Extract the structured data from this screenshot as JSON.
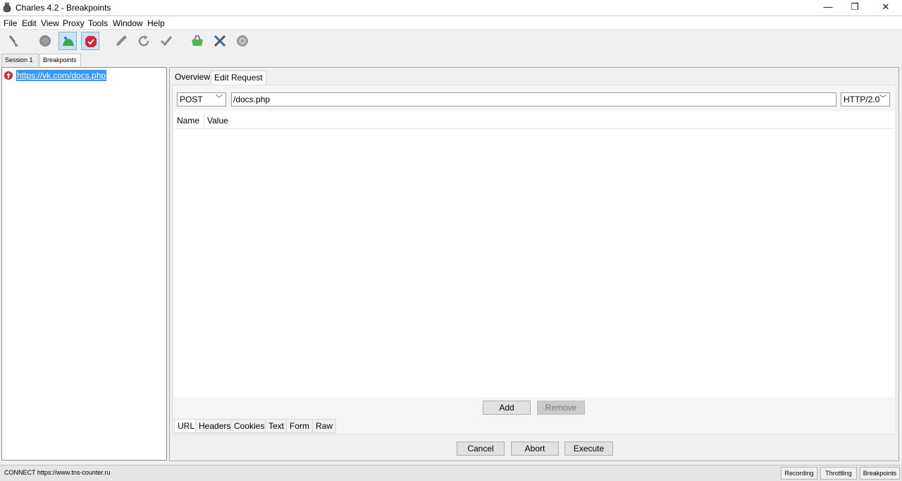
{
  "window": {
    "title": "Charles 4.2 - Breakpoints",
    "controls": {
      "minimize": "—",
      "restore": "❐",
      "close": "✕"
    }
  },
  "menu": [
    "File",
    "Edit",
    "View",
    "Proxy",
    "Tools",
    "Window",
    "Help"
  ],
  "toolbar": {
    "buttons": [
      {
        "icon": "broom-icon"
      },
      {
        "icon": "record-icon"
      },
      {
        "icon": "throttle-icon",
        "active": true
      },
      {
        "icon": "breakpoint-icon",
        "active": true
      },
      {
        "icon": "pen-icon"
      },
      {
        "icon": "refresh-icon"
      },
      {
        "icon": "check-icon"
      },
      {
        "icon": "basket-icon"
      },
      {
        "icon": "tools-icon"
      },
      {
        "icon": "settings-gear-icon"
      }
    ]
  },
  "session_tabs": {
    "session": "Session 1",
    "session_modified": "*",
    "breakpoints": "Breakpoints"
  },
  "tree": {
    "selected_url": "https://vk.com/docs.php"
  },
  "panel_tabs": {
    "overview": "Overview",
    "edit_request": "Edit Request"
  },
  "request": {
    "method": "POST",
    "path": "/docs.php",
    "protocol": "HTTP/2.0"
  },
  "table": {
    "col_name": "Name",
    "col_value": "Value"
  },
  "table_buttons": {
    "add": "Add",
    "remove": "Remove"
  },
  "sub_tabs": [
    "URL",
    "Headers",
    "Cookies",
    "Text",
    "Form",
    "Raw"
  ],
  "actions": {
    "cancel": "Cancel",
    "abort": "Abort",
    "execute": "Execute"
  },
  "status": {
    "message": "CONNECT https://www.tns-counter.ru",
    "recording": "Recording",
    "throttling": "Throttling",
    "breakpoints": "Breakpoints"
  },
  "colors": {
    "selection": "#3399ff",
    "breakpoint_red": "#d9232e",
    "active_tool": "#c9e3f7"
  }
}
